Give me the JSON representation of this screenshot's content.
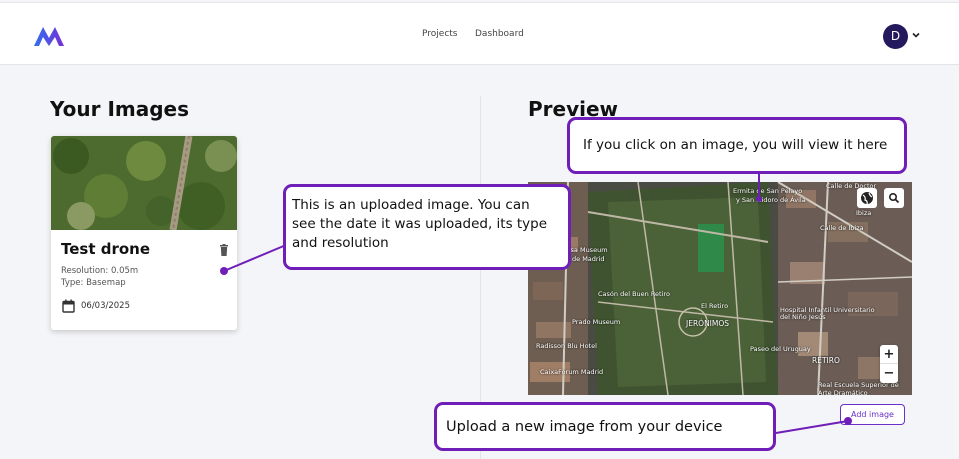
{
  "nav": {
    "projects": "Projects",
    "dashboard": "Dashboard"
  },
  "user": {
    "initial": "D"
  },
  "left": {
    "title": "Your Images"
  },
  "right": {
    "title": "Preview"
  },
  "card": {
    "title": "Test drone",
    "resolution": "Resolution: 0.05m",
    "type": "Type: Basemap",
    "date": "06/03/2025"
  },
  "map": {
    "labels": [
      "Ermita de San Pelayo",
      "y San Isidoro de Ávila",
      "Calle de Doctor",
      "Calle de Ibiza",
      "Casa Museum",
      "de Madrid",
      "Casón del Buen Retiro",
      "El Retiro",
      "JERÓNIMOS",
      "Prado Museum",
      "Hospital Infantil Universitario del Niño Jesús",
      "Radisson Blu Hotel",
      "CaixaForum Madrid",
      "RETIRO",
      "Real Escuela Superior de Arte Dramático",
      "Paseo del Uruguay",
      "Ibiza"
    ],
    "zoom_in": "+",
    "zoom_out": "−"
  },
  "add_image_label": "Add image",
  "callouts": {
    "preview": "If you click on an image, you will view it here",
    "uploaded": "This is an uploaded image. You can see the date it was uploaded, its type and resolution",
    "upload": "Upload a new image from your device"
  },
  "colors": {
    "accent": "#6f1fb8",
    "avatar": "#24195c",
    "logo_start": "#2f6ff0",
    "logo_end": "#7a2fd6"
  }
}
